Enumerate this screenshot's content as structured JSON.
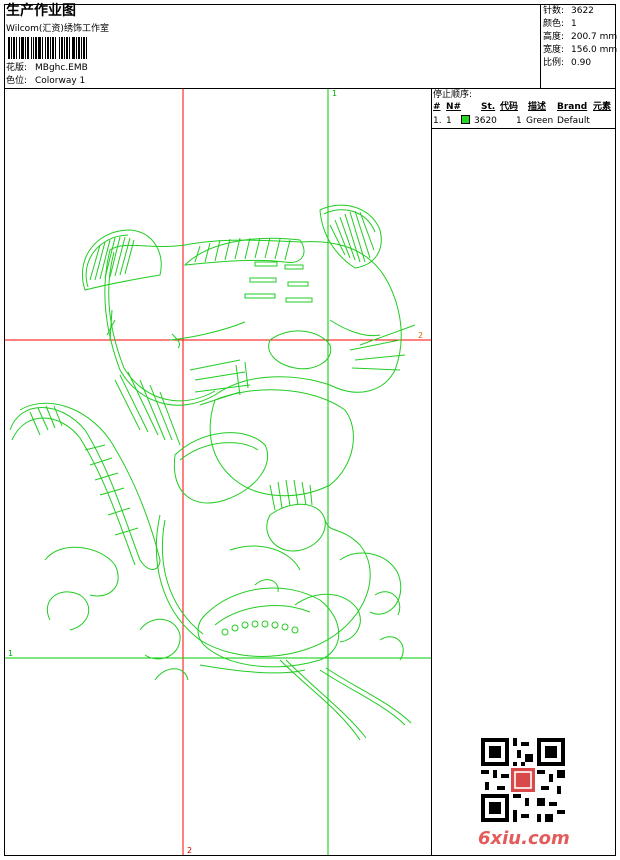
{
  "header": {
    "title": "生产作业图",
    "studio": "Wilcom(汇资)绣饰工作室",
    "design_label": "花版:",
    "design_value": "MBghc.EMB",
    "colorway_label": "色位:",
    "colorway_value": "Colorway 1"
  },
  "stats": {
    "stitches_label": "针数:",
    "stitches_value": "3622",
    "colors_label": "颜色:",
    "colors_value": "1",
    "height_label": "高度:",
    "height_value": "200.7 mm",
    "width_label": "宽度:",
    "width_value": "156.0 mm",
    "scale_label": "比例:",
    "scale_value": "0.90"
  },
  "stop_sequence": {
    "title": "停止顺序:",
    "columns": [
      "#",
      "N#",
      "St.",
      "代码",
      "描述",
      "Brand",
      "元素"
    ],
    "rows": [
      {
        "index": "1.",
        "needle": "1",
        "stitches": "3620",
        "code": "1",
        "description": "Green",
        "brand": "Default",
        "swatch_color": "#22d622"
      }
    ]
  },
  "canvas": {
    "frame_labels": {
      "top": "1",
      "right": "2",
      "left": "1",
      "bottom": "2"
    },
    "design_color": "#22cc22",
    "guide_red": "#ff0000",
    "guide_green": "#00cc00"
  },
  "watermark": {
    "text": "6xiu.com",
    "color": "#e35b5b",
    "qr_icon": "qr-code-icon"
  }
}
